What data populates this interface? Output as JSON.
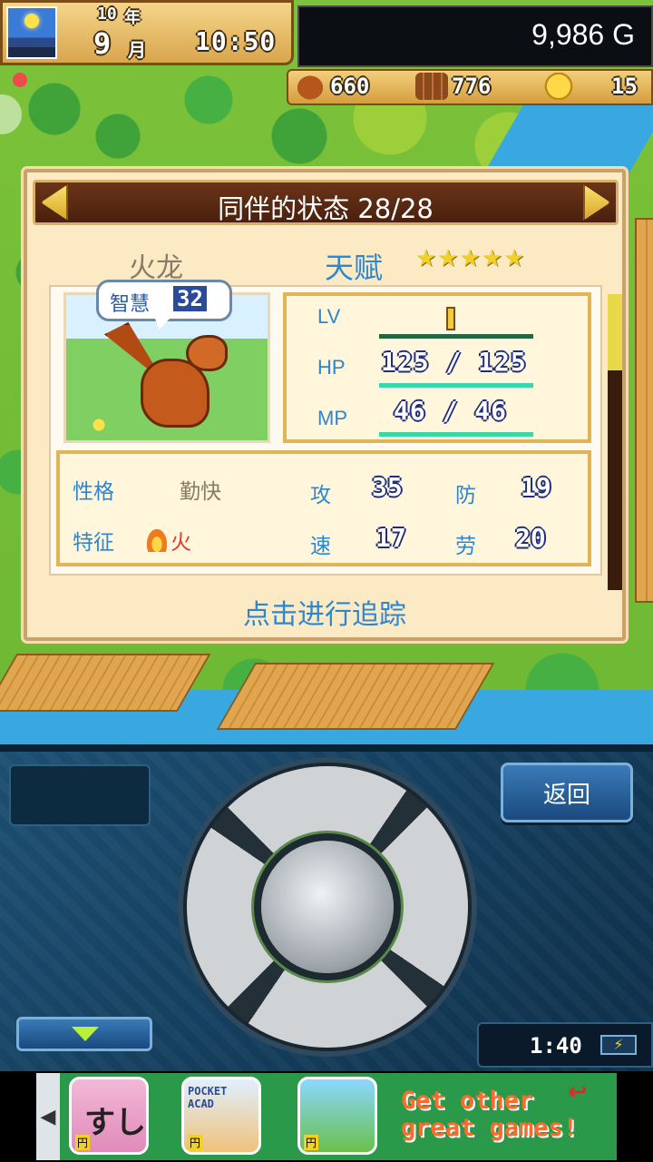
{
  "hud": {
    "year_num": "10",
    "year_label": "年",
    "month_num": "9",
    "month_label": "月",
    "time": "10:50",
    "money": "9,986 G",
    "resources": {
      "food": "660",
      "wood": "776",
      "medals": "15"
    }
  },
  "dialog": {
    "title": "同伴的状态 28/28",
    "name": "火龙",
    "talent_label": "天赋",
    "talent_stars": "★★★★★",
    "wisdom_label": "智慧",
    "wisdom_value": "32",
    "lv_label": "LV",
    "lv_value": "1",
    "hp_label": "HP",
    "hp_value": "125 / 125",
    "mp_label": "MP",
    "mp_value": "46 / 46",
    "personality_label": "性格",
    "personality_value": "勤快",
    "trait_label": "特征",
    "trait_value": "火",
    "attack_label": "攻",
    "attack_value": "35",
    "defense_label": "防",
    "defense_value": "19",
    "speed_label": "速",
    "speed_value": "17",
    "labor_label": "劳",
    "labor_value": "20",
    "track_link": "点击进行追踪"
  },
  "controller": {
    "back_label": "返回",
    "clock": "1:40",
    "battery_glyph": "⚡"
  },
  "ad": {
    "arrow_glyph": "◀",
    "app1_text": "すし",
    "app1_badge": "円",
    "app2_text": "POCKET ACAD",
    "app2_badge": "円",
    "app3_badge": "円",
    "return_glyph": "↩",
    "text": "Get other great games!"
  },
  "colors": {
    "accent_blue": "#2c86d0",
    "dialog_bg": "#fbeac4",
    "header_brown": "#5a2a12",
    "controller_blue": "#1c4f72"
  }
}
